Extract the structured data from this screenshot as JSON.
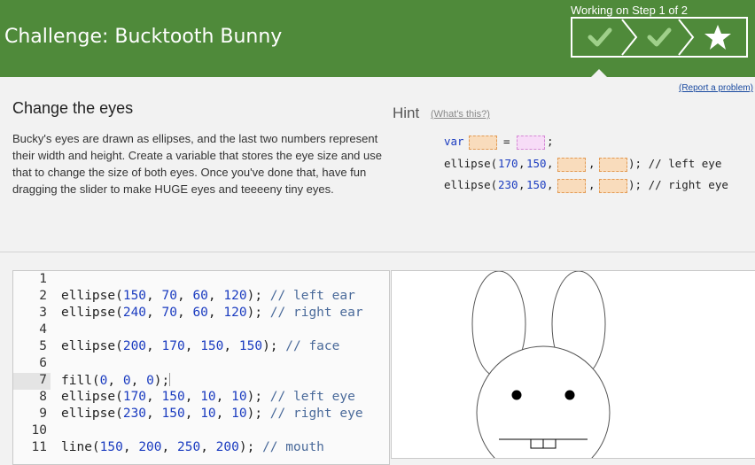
{
  "header": {
    "title": "Challenge: Bucktooth Bunny",
    "step_status": "Working on Step 1 of 2",
    "steps": [
      "check-icon",
      "check-icon",
      "star-icon"
    ],
    "bg_color": "#4f8a3a"
  },
  "report_link": "(Report a problem)",
  "step": {
    "title": "Change the eyes",
    "description": "Bucky's eyes are drawn as ellipses, and the last two numbers represent their width and height. Create a variable that stores the eye size and use that to change the size of both eyes. Once you've done that, have fun dragging the slider to make HUGE eyes and teeeeny tiny eyes."
  },
  "hint": {
    "title": "Hint",
    "link": "(What's this?)",
    "var_kw": "var",
    "eq": "=",
    "semi": ";",
    "l2_fn": "ellipse(",
    "l2_a": "170",
    "l2_b": "150",
    "l2_tail": "); // left eye",
    "l3_fn": "ellipse(",
    "l3_a": "230",
    "l3_b": "150",
    "l3_tail": "); // right eye",
    "comma": ","
  },
  "editor": {
    "line_numbers": [
      "1",
      "2",
      "3",
      "4",
      "5",
      "6",
      "7",
      "8",
      "9",
      "10",
      "11"
    ],
    "active_line": 7,
    "lines": {
      "l2": {
        "fn": "ellipse(",
        "args": [
          "150",
          "70",
          "60",
          "120"
        ],
        "comment": "// left ear"
      },
      "l3": {
        "fn": "ellipse(",
        "args": [
          "240",
          "70",
          "60",
          "120"
        ],
        "comment": "// right ear"
      },
      "l5": {
        "fn": "ellipse(",
        "args": [
          "200",
          "170",
          "150",
          "150"
        ],
        "comment": "// face"
      },
      "l7": {
        "fn": "fill(",
        "args": [
          "0",
          "0",
          "0"
        ],
        "comment": ""
      },
      "l8": {
        "fn": "ellipse(",
        "args": [
          "170",
          "150",
          "10",
          "10"
        ],
        "comment": "// left eye"
      },
      "l9": {
        "fn": "ellipse(",
        "args": [
          "230",
          "150",
          "10",
          "10"
        ],
        "comment": "// right eye"
      },
      "l11": {
        "fn": "line(",
        "args": [
          "150",
          "200",
          "250",
          "200"
        ],
        "comment": "// mouth"
      }
    }
  }
}
